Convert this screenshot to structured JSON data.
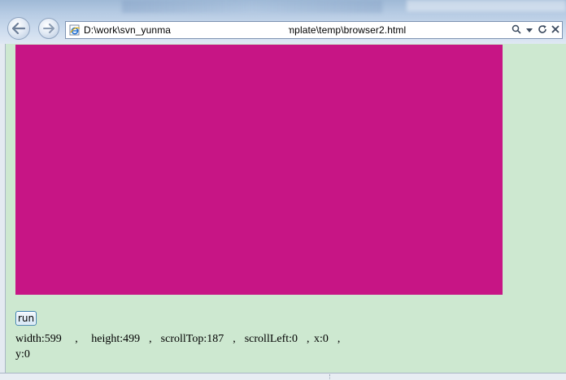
{
  "browser": {
    "address_prefix": "D:\\work\\svn_yunma",
    "address_suffix": "mplate\\temp\\browser2.html",
    "icons": {
      "back": "arrow-left",
      "forward": "arrow-right",
      "page": "ie-icon",
      "search": "magnifier",
      "dropdown": "chevron-down",
      "refresh": "refresh",
      "stop": "close"
    }
  },
  "page": {
    "background_color": "#cde8d0",
    "box_color": "#c71585",
    "run_label": "run",
    "stats_line": "width:599   ,   height:499  ,  scrollTop:187  ,  scrollLeft:0  , x:0  ,",
    "stats_line2": "y:0"
  }
}
